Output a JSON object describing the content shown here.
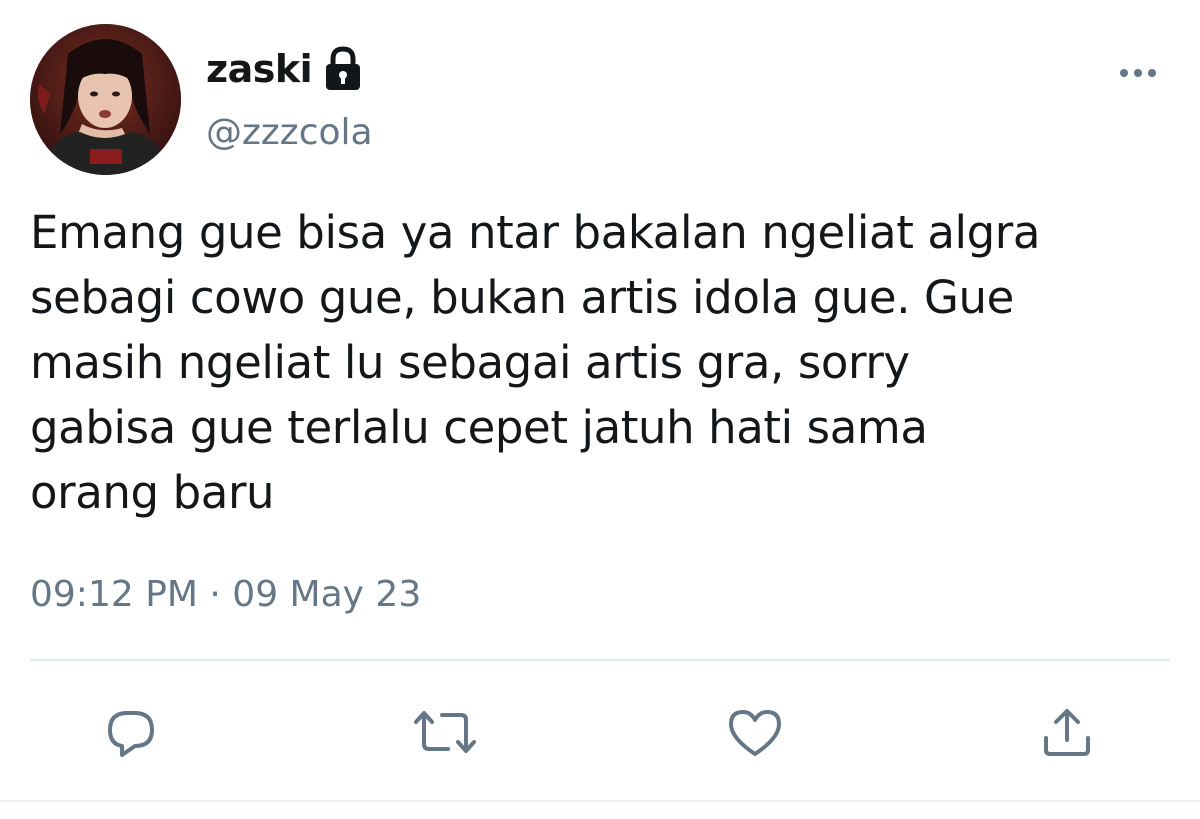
{
  "user": {
    "display_name": "zaski",
    "handle": "@zzzcola",
    "protected_icon": "lock-icon",
    "avatar": "profile-photo"
  },
  "tweet": {
    "lines": [
      "Emang gue bisa ya ntar bakalan ngeliat algra",
      "sebagi cowo gue, bukan artis idola gue. Gue",
      "masih ngeliat lu sebagai artis gra, sorry",
      "gabisa gue terlalu cepet jatuh hati sama",
      "orang baru"
    ],
    "timestamp": "09:12 PM · 09 May 23"
  },
  "actions": {
    "reply_icon": "reply-icon",
    "retweet_icon": "retweet-icon",
    "like_icon": "heart-icon",
    "share_icon": "share-icon",
    "more_icon": "more-dots-icon"
  },
  "colors": {
    "text": "#14171a",
    "secondary": "#657786",
    "divider": "#e1e8ed"
  }
}
